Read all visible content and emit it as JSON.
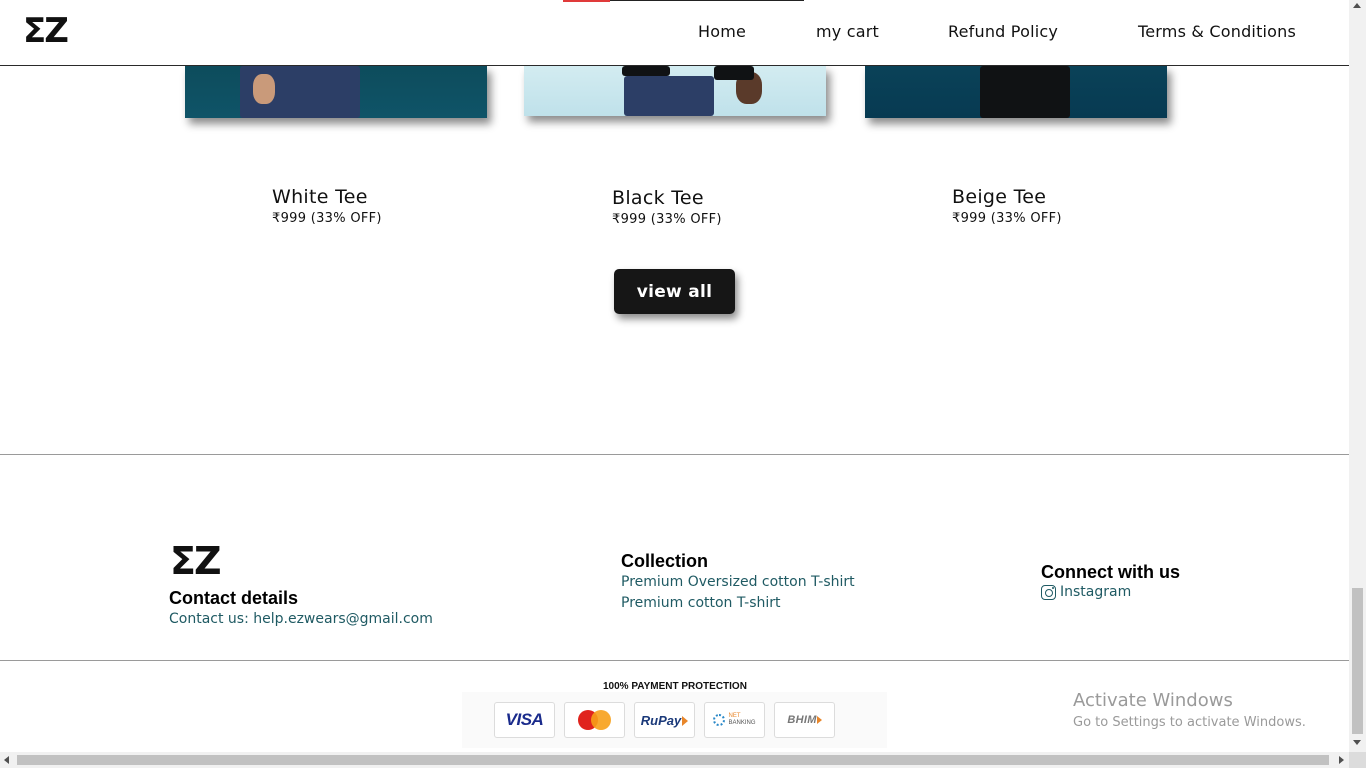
{
  "header": {
    "logo": "ΣZ",
    "nav": [
      "Home",
      "my cart",
      "Refund Policy",
      "Terms & Conditions"
    ]
  },
  "products": [
    {
      "name": "White Tee",
      "price": "₹999 (33% OFF)"
    },
    {
      "name": "Black Tee",
      "price": "₹999 (33% OFF)"
    },
    {
      "name": "Beige Tee",
      "price": "₹999 (33% OFF)"
    }
  ],
  "view_all_label": "view all",
  "footer": {
    "logo": "ΣZ",
    "contact_heading": "Contact details",
    "contact_text": "Contact us: help.ezwears@gmail.com",
    "collection_heading": "Collection",
    "collection_items": [
      "Premium Oversized cotton T-shirt",
      "Premium cotton T-shirt"
    ],
    "connect_heading": "Connect with us",
    "instagram_label": "Instagram"
  },
  "payment": {
    "title": "100% PAYMENT PROTECTION",
    "methods": {
      "visa": "VISA",
      "mastercard": "mastercard",
      "rupay": "RuPay",
      "netbanking_line1": "NET",
      "netbanking_line2": "BANKING",
      "bhim": "BHIM"
    }
  },
  "windows_watermark": {
    "title": "Activate Windows",
    "subtitle": "Go to Settings to activate Windows."
  },
  "colors": {
    "link": "#1f5a63",
    "button_bg": "#161616",
    "divider": "#9a9a9a"
  }
}
